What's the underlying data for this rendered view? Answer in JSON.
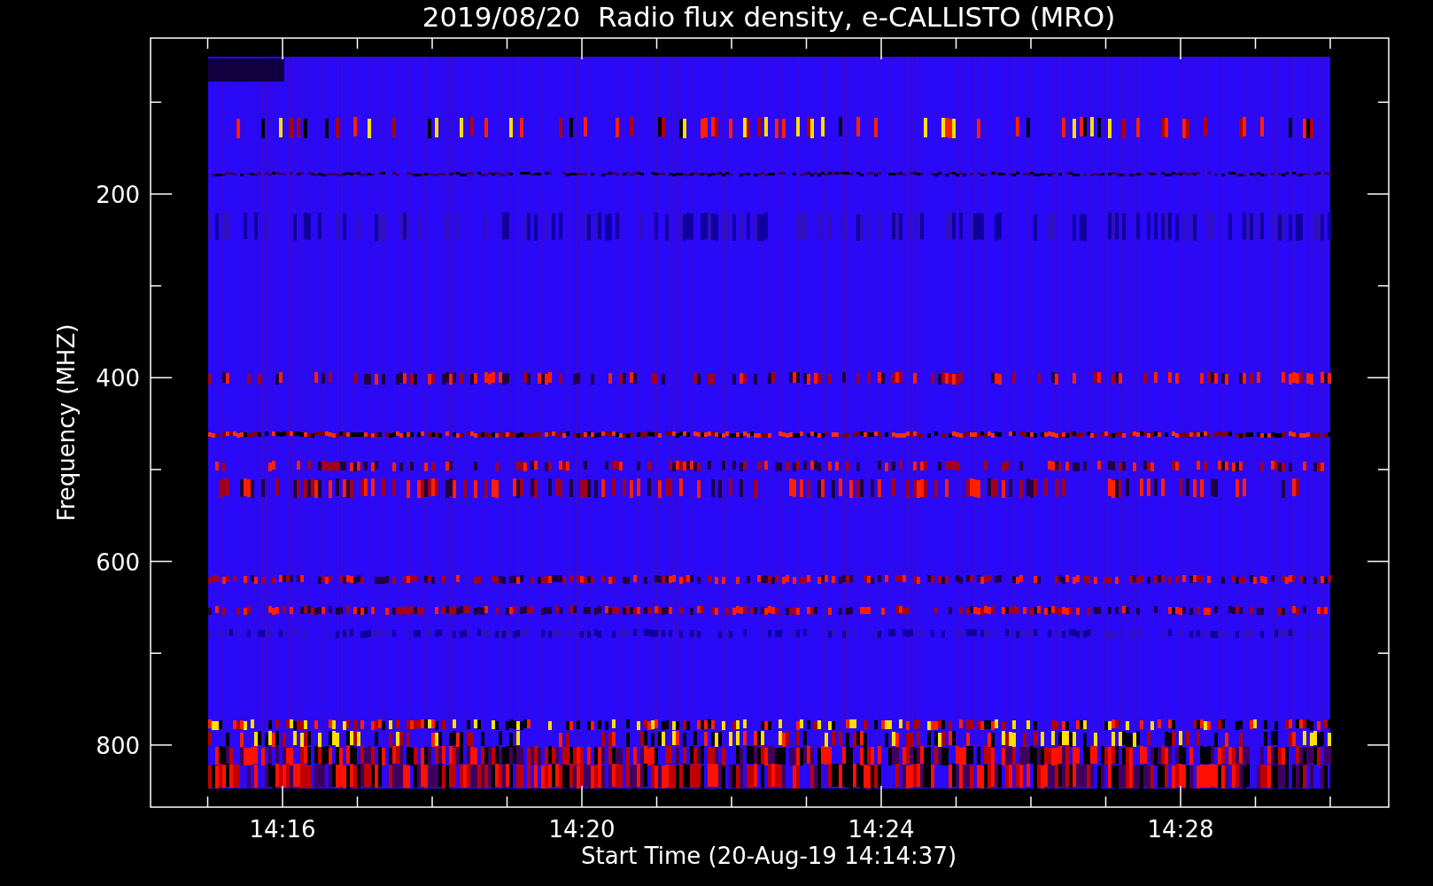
{
  "title": "2019/08/20  Radio flux density, e-CALLISTO (MRO)",
  "y_axis": {
    "label": "Frequency (MHZ)",
    "tick_labels": [
      "200",
      "400",
      "600",
      "800"
    ]
  },
  "x_axis": {
    "label": "Start Time (20-Aug-19 14:14:37)",
    "tick_labels": [
      "14:16",
      "14:20",
      "14:24",
      "14:28"
    ]
  }
}
